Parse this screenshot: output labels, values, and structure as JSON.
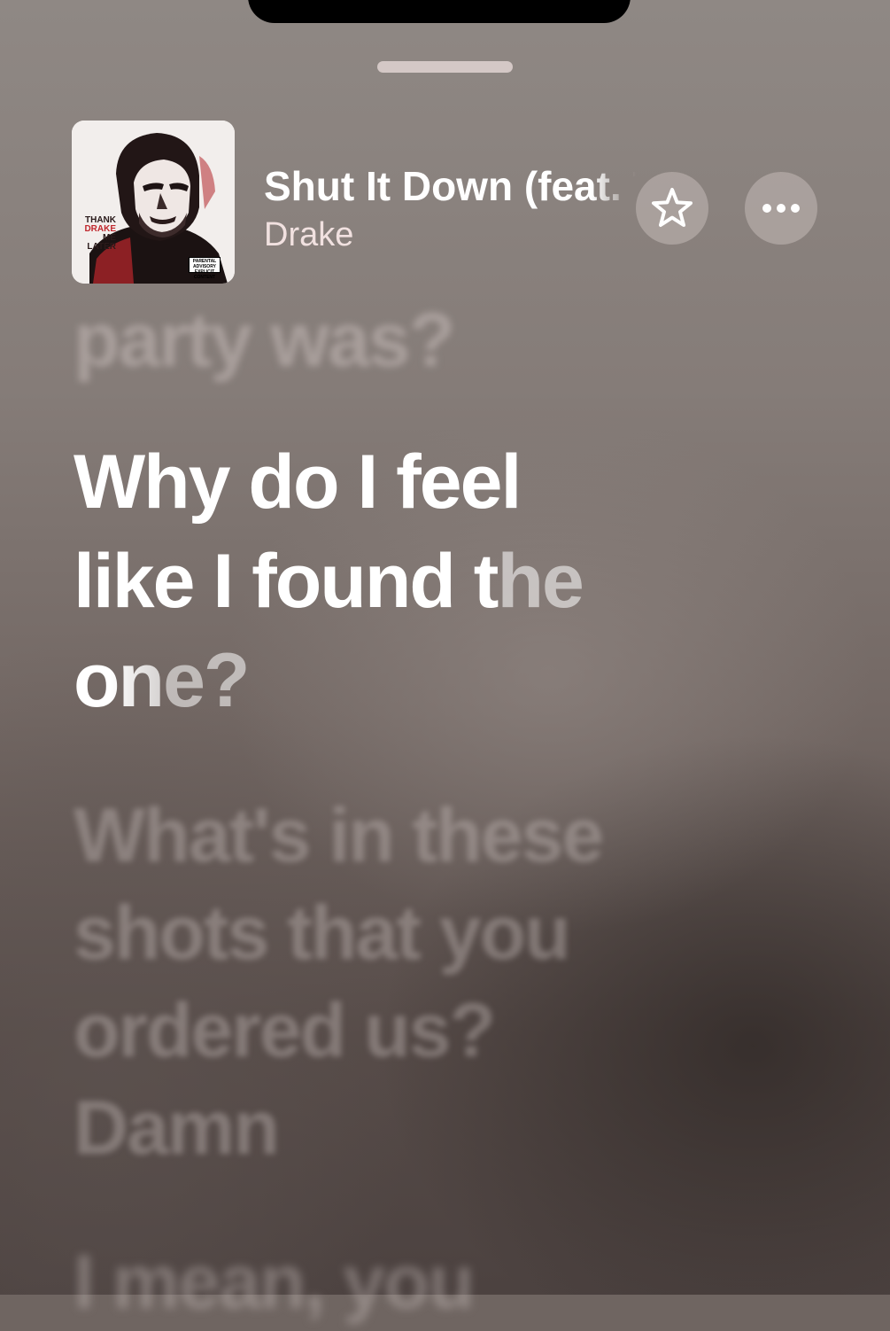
{
  "now_playing": {
    "title": "Shut It Down (feat. The-Dream)",
    "artist": "Drake",
    "album_art": {
      "name": "album-art",
      "art_text_lines": [
        "THANK",
        "DRAKE",
        "ME",
        "LATER"
      ],
      "advisory_text": "PARENTAL ADVISORY EXPLICIT CONTENT"
    }
  },
  "icons": {
    "star": "star-icon",
    "more": "ellipsis-icon"
  },
  "lyrics": {
    "previous_line": "party was?",
    "current_lines": [
      "Why do I feel",
      "like I found t",
      "he",
      "on",
      "e?"
    ],
    "upcoming_lines": [
      "What's in these",
      "shots that you",
      "ordered us?",
      "Damn"
    ],
    "tail_line": "I mean, you"
  },
  "colors": {
    "title": "#ffffff",
    "artist": "#f1e1e0",
    "lyric_active": "#ffffff",
    "grabber": "#d4c8c6"
  }
}
